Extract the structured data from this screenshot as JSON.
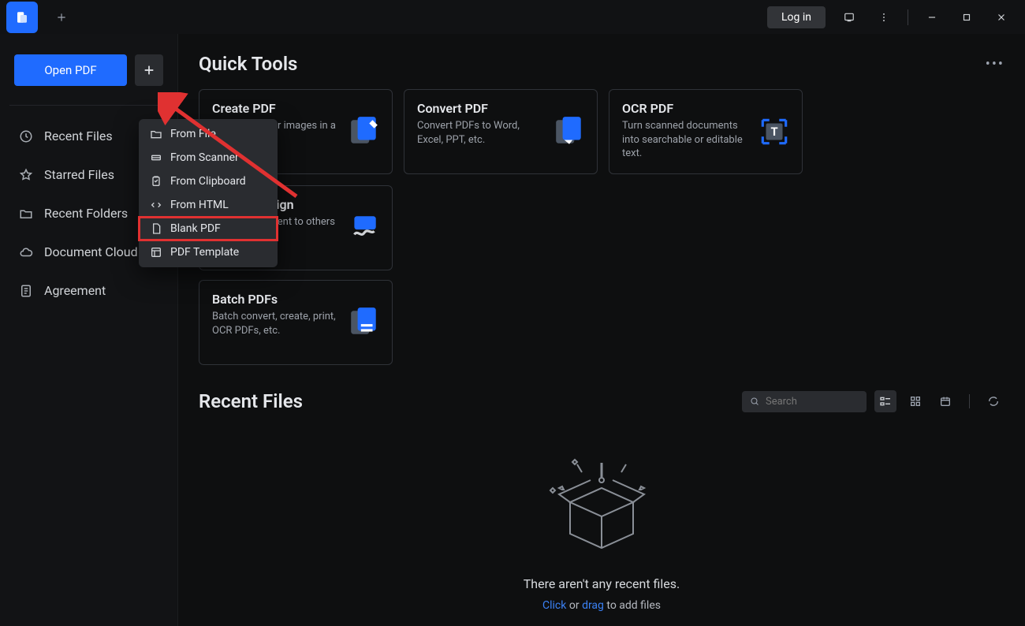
{
  "titlebar": {
    "login_label": "Log in"
  },
  "sidebar": {
    "open_pdf_label": "Open PDF",
    "items": [
      {
        "label": "Recent Files"
      },
      {
        "label": "Starred Files"
      },
      {
        "label": "Recent Folders"
      },
      {
        "label": "Document Cloud"
      },
      {
        "label": "Agreement"
      }
    ]
  },
  "dropdown": {
    "items": [
      {
        "label": "From File"
      },
      {
        "label": "From Scanner"
      },
      {
        "label": "From Clipboard"
      },
      {
        "label": "From HTML"
      },
      {
        "label": "Blank PDF"
      },
      {
        "label": "PDF Template"
      }
    ]
  },
  "quicktools": {
    "title": "Quick Tools",
    "more": "•••",
    "cards": [
      {
        "title": "Create PDF",
        "desc": "Convert files or images in a PDF."
      },
      {
        "title": "Convert PDF",
        "desc": "Convert PDFs to Word, Excel, PPT, etc."
      },
      {
        "title": "OCR PDF",
        "desc": "Turn scanned documents into searchable or editable text."
      },
      {
        "title": "Request eSign",
        "desc": "Send a document to others for signing."
      },
      {
        "title": "Batch PDFs",
        "desc": "Batch convert, create, print, OCR PDFs, etc."
      }
    ]
  },
  "recent": {
    "title": "Recent Files",
    "search_placeholder": "Search",
    "empty_line": "There aren't any recent files.",
    "empty_click": "Click",
    "empty_or": " or ",
    "empty_drag": "drag",
    "empty_tail": " to add files"
  }
}
